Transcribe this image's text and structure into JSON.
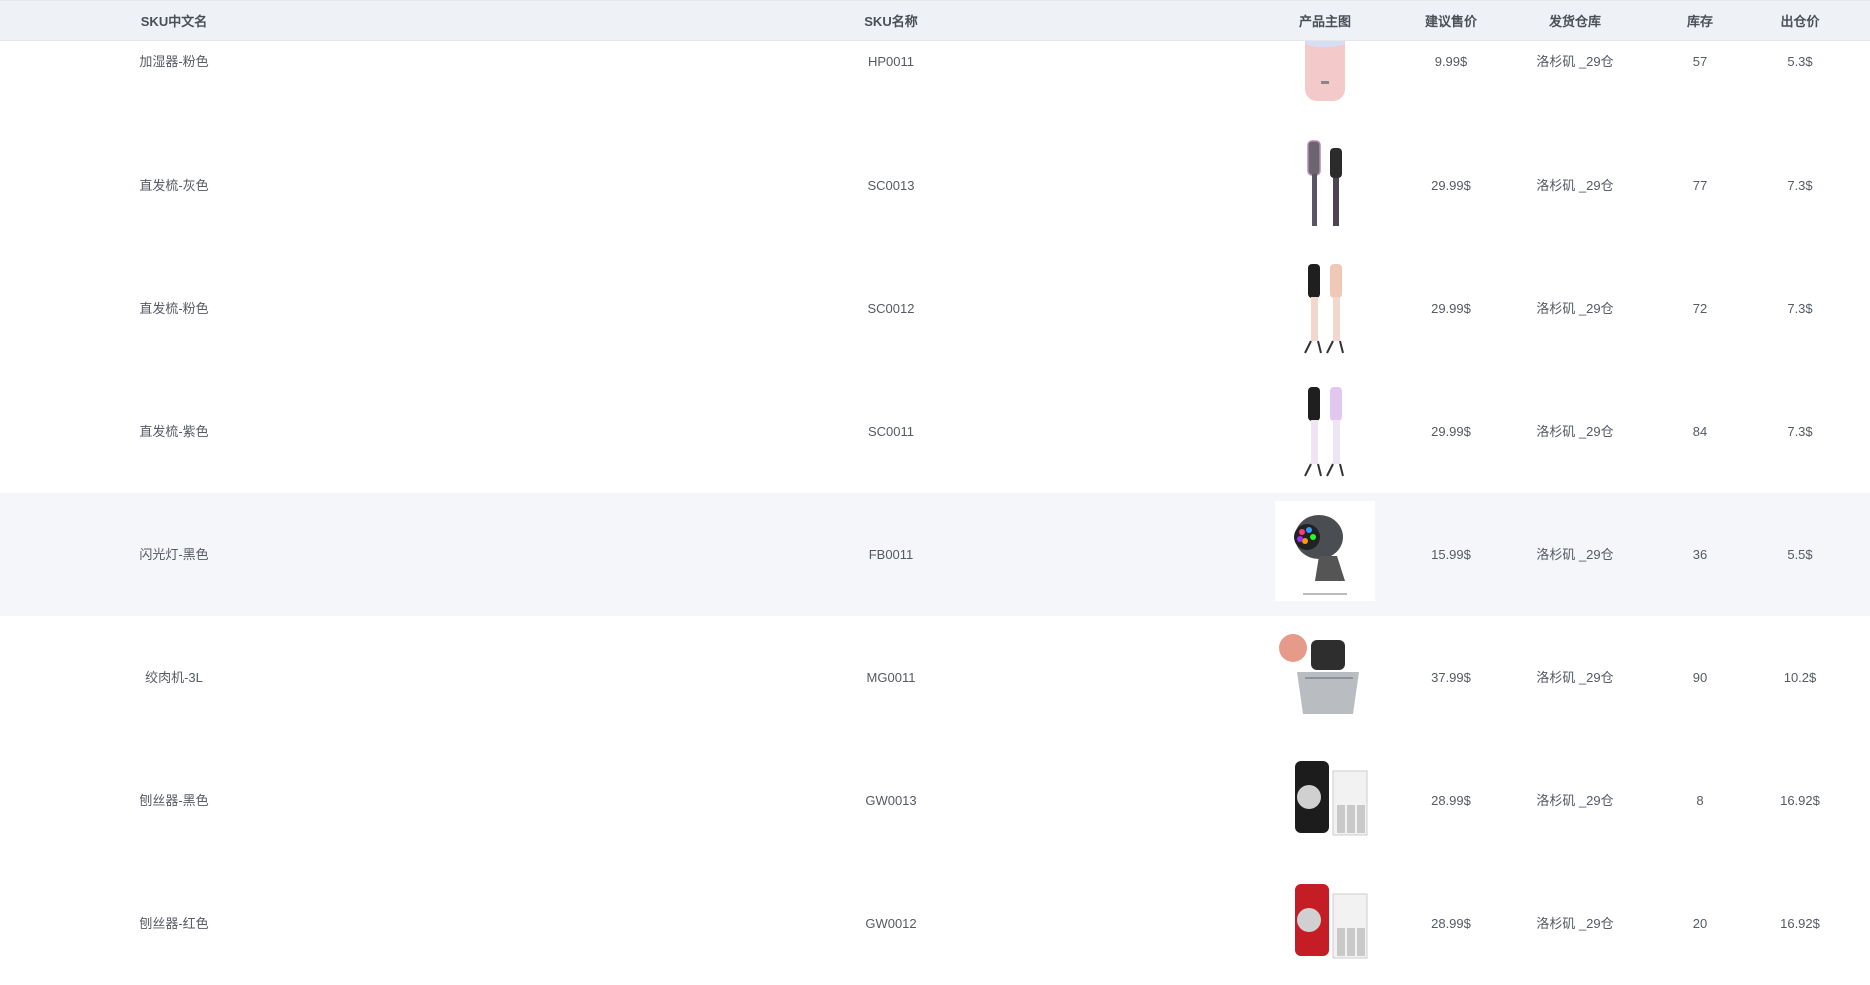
{
  "columns": {
    "name_cn": "SKU中文名",
    "sku": "SKU名称",
    "image": "产品主图",
    "price": "建议售价",
    "warehouse": "发货仓库",
    "stock": "库存",
    "out_price": "出仓价"
  },
  "rows": [
    {
      "name_cn": "加湿器-粉色",
      "sku": "HP0011",
      "image": "pink-humidifier-image",
      "price": "9.99$",
      "warehouse": "洛杉矶 _29仓",
      "stock": "57",
      "out_price": "5.3$"
    },
    {
      "name_cn": "直发梳-灰色",
      "sku": "SC0013",
      "image": "gray-straightener-comb-image",
      "price": "29.99$",
      "warehouse": "洛杉矶 _29仓",
      "stock": "77",
      "out_price": "7.3$"
    },
    {
      "name_cn": "直发梳-粉色",
      "sku": "SC0012",
      "image": "pink-straightener-comb-image",
      "price": "29.99$",
      "warehouse": "洛杉矶 _29仓",
      "stock": "72",
      "out_price": "7.3$"
    },
    {
      "name_cn": "直发梳-紫色",
      "sku": "SC0011",
      "image": "purple-straightener-comb-image",
      "price": "29.99$",
      "warehouse": "洛杉矶 _29仓",
      "stock": "84",
      "out_price": "7.3$"
    },
    {
      "name_cn": "闪光灯-黑色",
      "sku": "FB0011",
      "image": "black-strobe-light-image",
      "price": "15.99$",
      "warehouse": "洛杉矶 _29仓",
      "stock": "36",
      "out_price": "5.5$"
    },
    {
      "name_cn": "绞肉机-3L",
      "sku": "MG0011",
      "image": "meat-grinder-image",
      "price": "37.99$",
      "warehouse": "洛杉矶 _29仓",
      "stock": "90",
      "out_price": "10.2$"
    },
    {
      "name_cn": "刨丝器-黑色",
      "sku": "GW0013",
      "image": "black-grater-image",
      "price": "28.99$",
      "warehouse": "洛杉矶 _29仓",
      "stock": "8",
      "out_price": "16.92$"
    },
    {
      "name_cn": "刨丝器-红色",
      "sku": "GW0012",
      "image": "red-grater-image",
      "price": "28.99$",
      "warehouse": "洛杉矶 _29仓",
      "stock": "20",
      "out_price": "16.92$"
    }
  ],
  "colors": {
    "header_bg": "#eef1f5",
    "hover_row_bg": "#f4f6f9",
    "text": "#555a63"
  }
}
